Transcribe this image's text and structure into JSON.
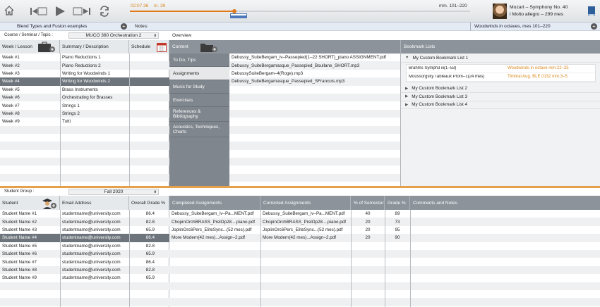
{
  "toolbar": {
    "time": "02:07.36",
    "measure": "m. 39",
    "range": "mm. 101–220",
    "piece_title": "Mozart – Symphony No. 40",
    "piece_sub": "i Molto allegro – 299 mes"
  },
  "infobar": {
    "blend": "Blend Types and Fusion examples",
    "notes_label": "Notes:",
    "woodwinds": "Woodwinds in octaves, mes 101–220"
  },
  "course": {
    "label": "Course / Seminar / Topic :",
    "value": "MUCO 360 Orchestration 2",
    "overview": "Overview"
  },
  "lessons": {
    "col_week": "Week / Lesson",
    "col_summary": "Summary / Description",
    "col_schedule": "Schedule",
    "selected": 3,
    "rows": [
      {
        "week": "Week #1",
        "summary": "Piano Reductions 1"
      },
      {
        "week": "Week #2",
        "summary": "Piano Reductions 2"
      },
      {
        "week": "Week #3",
        "summary": "Writing for Woodwinds 1"
      },
      {
        "week": "Week #4",
        "summary": "Writing for Woodwinds 2"
      },
      {
        "week": "Week #5",
        "summary": "Brass Instruments"
      },
      {
        "week": "Week #6",
        "summary": "Orchestrating for Brasses"
      },
      {
        "week": "Week #7",
        "summary": "Strings 1"
      },
      {
        "week": "Week #8",
        "summary": "Strings 2"
      },
      {
        "week": "Week #9",
        "summary": "Tutti"
      }
    ]
  },
  "content": {
    "header": "Content",
    "selected": 1,
    "menu": [
      "To Do, Tips",
      "Assignments",
      "Music for Study",
      "Exercises",
      "References & Bibliography",
      "Acoustics, Techniques, Charts"
    ],
    "files": [
      "Debussy_SuiteBergam_iv–Passepied(1–22 SHORT)_piano ASSIGNMENT.pdf",
      "Debussy_SuiteBergamasque_Passepied_Boullane_SHORT.mp3",
      "DebussySuiteBergam–4(Roge).mp3",
      "Debussy_SuiteBergamasque_Passepied_SFrancois.mp3"
    ]
  },
  "bookmarks": {
    "header": "Bookmark Lists",
    "lists": [
      {
        "name": "My Custom Bookmark List 1",
        "open": true,
        "items": [
          {
            "title": "Brahms Symph3 iii(1–53)",
            "note": "Woodwinds in octave mm.22–25"
          },
          {
            "title": "Moussorgsky Tableaux Prom–1(24 mes)",
            "note": "Timbral Aug. BLE 0132 mm.3–5"
          }
        ]
      },
      {
        "name": "My Custom Bookmark List 2",
        "open": false
      },
      {
        "name": "My Custom Bookmark List 3",
        "open": false
      },
      {
        "name": "My Custom Bookmark List 4",
        "open": false
      }
    ]
  },
  "students": {
    "group_label": "Student Group :",
    "group_value": "Fall 2020",
    "col_student": "Student",
    "col_email": "Email Address",
    "col_grade": "Overall Grade %",
    "col_completed": "Completed Assignments",
    "col_corrected": "Corrected Assignments",
    "col_semester": "% of Semester",
    "col_gradep": "Grade %",
    "col_comments": "Comments and Notes",
    "selected": 3,
    "rows": [
      {
        "name": "Student Name #1",
        "email": "studentname@university.com",
        "grade": "86.4"
      },
      {
        "name": "Student Name #2",
        "email": "studentname@university.com",
        "grade": "82.8"
      },
      {
        "name": "Student Name #3",
        "email": "studentname@university.com",
        "grade": "65.9"
      },
      {
        "name": "Student Name #4",
        "email": "studentname@university.com",
        "grade": "86.4"
      },
      {
        "name": "Student Name #5",
        "email": "studentname@university.com",
        "grade": "82.8"
      },
      {
        "name": "Student Name #6",
        "email": "studentname@university.com",
        "grade": "65.9"
      },
      {
        "name": "Student Name #7",
        "email": "studentname@university.com",
        "grade": "86.4"
      },
      {
        "name": "Student Name #8",
        "email": "studentname@university.com",
        "grade": "82.8"
      },
      {
        "name": "Student Name #9",
        "email": "studentname@university.com",
        "grade": "65.9"
      }
    ],
    "assignments": [
      {
        "completed": "Debussy_SuiteBergam_iv–Pa...MENT.pdf",
        "corrected": "Debussy_SuiteBergam_iv–Pa...MENT.pdf",
        "semester": "40",
        "grade": "89"
      },
      {
        "completed": "ChopinOrchBRASS_PrelOp28....piano.pdf",
        "corrected": "ChopinOrchBRASS_PrelOp28....piano.pdf",
        "semester": "20",
        "grade": "73"
      },
      {
        "completed": "JoplinOrc6Perc_EliteSync...(52 mes).pdf",
        "corrected": "JoplinOrc6Perc_EliteSync...(52 mes).pdf",
        "semester": "20",
        "grade": "95"
      },
      {
        "completed": "More Modern(42 mes)...Assign–2.pdf",
        "corrected": "More Modern(42 mes)...Assign–2.pdf",
        "semester": "20",
        "grade": "90"
      }
    ]
  },
  "colors": {
    "accent": "#e07a1a",
    "header_gray": "#8c939b",
    "selected_row": "#6d747b",
    "info_bar": "#e4ebf5",
    "note_orange": "#d9881e"
  }
}
